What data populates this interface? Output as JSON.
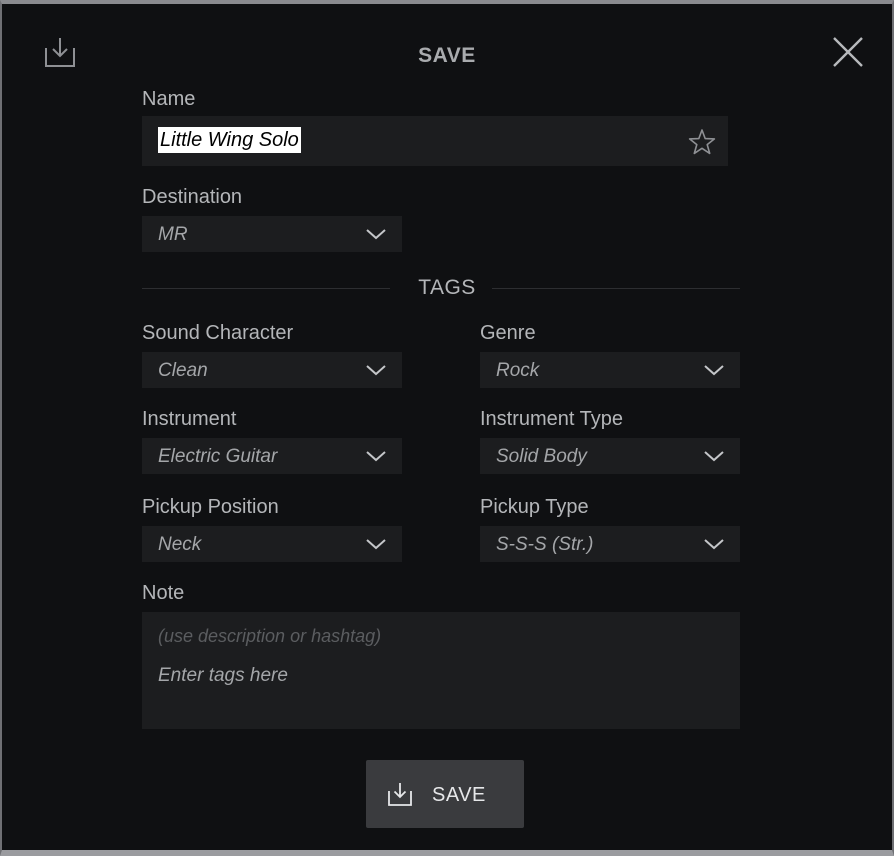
{
  "dialog": {
    "title": "SAVE",
    "name_label": "Name",
    "name_value": "Little Wing Solo",
    "destination_label": "Destination",
    "destination_value": "MR",
    "tags_title": "TAGS",
    "fields": {
      "sound_character": {
        "label": "Sound Character",
        "value": "Clean"
      },
      "genre": {
        "label": "Genre",
        "value": "Rock"
      },
      "instrument": {
        "label": "Instrument",
        "value": "Electric Guitar"
      },
      "instrument_type": {
        "label": "Instrument Type",
        "value": "Solid Body"
      },
      "pickup_position": {
        "label": "Pickup Position",
        "value": "Neck"
      },
      "pickup_type": {
        "label": "Pickup Type",
        "value": "S-S-S (Str.)"
      }
    },
    "note_label": "Note",
    "note_placeholder": "(use description or hashtag)",
    "tags_placeholder": "Enter tags here",
    "save_button_label": "SAVE"
  },
  "icons": {
    "header": "download-tray-icon",
    "close": "close-icon",
    "favorite": "star-outline-icon",
    "dropdown": "chevron-down-icon",
    "save": "download-tray-icon"
  },
  "colors": {
    "background": "#0f1012",
    "field": "#1c1d1f",
    "button": "#3a3b3e",
    "text": "#b4b6b9"
  }
}
